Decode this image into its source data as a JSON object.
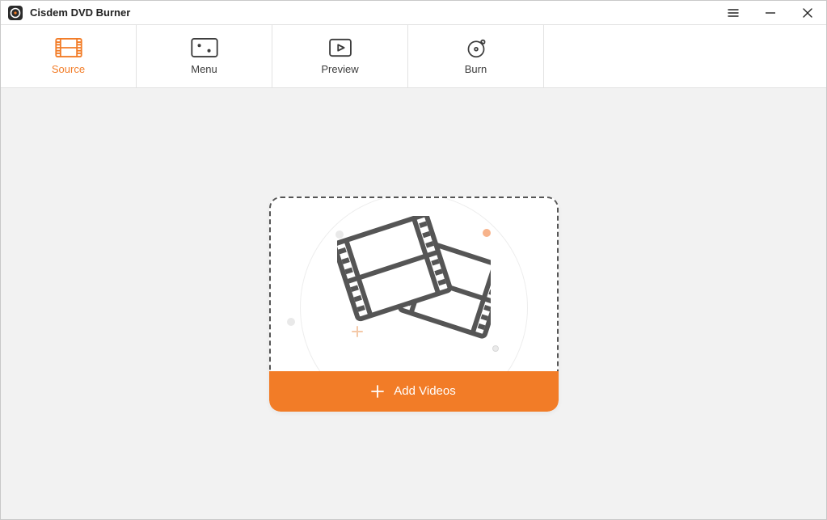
{
  "app": {
    "title": "Cisdem DVD Burner"
  },
  "tabs": [
    {
      "label": "Source",
      "active": true
    },
    {
      "label": "Menu",
      "active": false
    },
    {
      "label": "Preview",
      "active": false
    },
    {
      "label": "Burn",
      "active": false
    }
  ],
  "main": {
    "add_videos_label": "Add Videos"
  },
  "colors": {
    "accent": "#f27c27"
  }
}
